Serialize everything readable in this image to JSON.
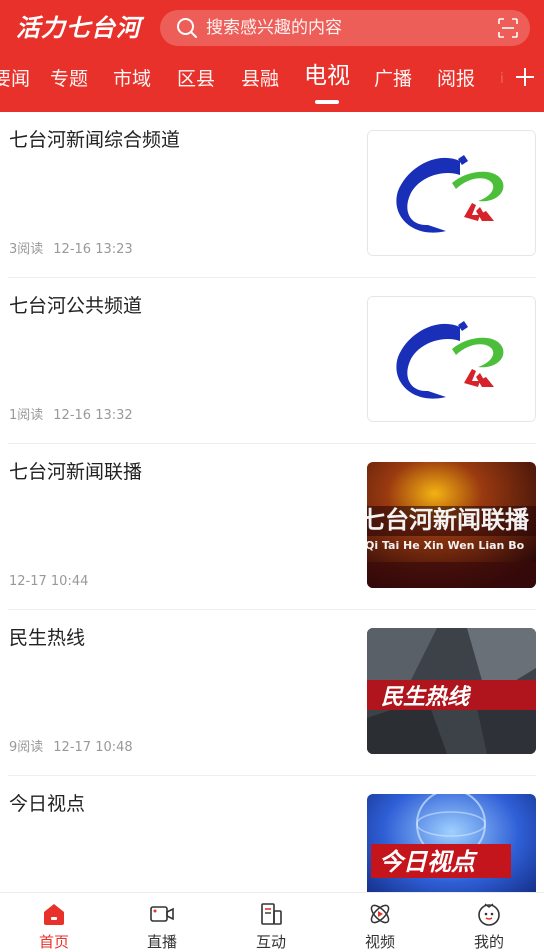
{
  "header": {
    "brand": "活力七台河",
    "search_placeholder": "搜索感兴趣的内容"
  },
  "tabs": [
    {
      "label": "要闻"
    },
    {
      "label": "专题"
    },
    {
      "label": "市域"
    },
    {
      "label": "区县"
    },
    {
      "label": "县融"
    },
    {
      "label": "电视",
      "active": true
    },
    {
      "label": "广播"
    },
    {
      "label": "阅报"
    },
    {
      "label": "i"
    }
  ],
  "articles": [
    {
      "title": "七台河新闻综合频道",
      "reads": "3阅读",
      "time": "12-16 13:23",
      "thumb": "logo"
    },
    {
      "title": "七台河公共频道",
      "reads": "1阅读",
      "time": "12-16 13:32",
      "thumb": "logo"
    },
    {
      "title": "七台河新闻联播",
      "reads": "",
      "time": "12-17 10:44",
      "thumb": "news",
      "thumb_text": "七台河新闻联播",
      "thumb_subtext": "Qi Tai He Xin Wen Lian Bo"
    },
    {
      "title": "民生热线",
      "reads": "9阅读",
      "time": "12-17 10:48",
      "thumb": "hotline",
      "thumb_text": "民生热线"
    },
    {
      "title": "今日视点",
      "reads": "",
      "time": "",
      "thumb": "viewpoint",
      "thumb_text": "今日视点"
    }
  ],
  "bottom_nav": [
    {
      "label": "首页",
      "icon": "home-icon",
      "active": true
    },
    {
      "label": "直播",
      "icon": "video-camera-icon"
    },
    {
      "label": "互动",
      "icon": "interact-icon"
    },
    {
      "label": "视频",
      "icon": "video-play-icon"
    },
    {
      "label": "我的",
      "icon": "profile-icon"
    }
  ],
  "colors": {
    "accent": "#e8312a",
    "text_primary": "#222222",
    "text_meta": "#999999"
  }
}
